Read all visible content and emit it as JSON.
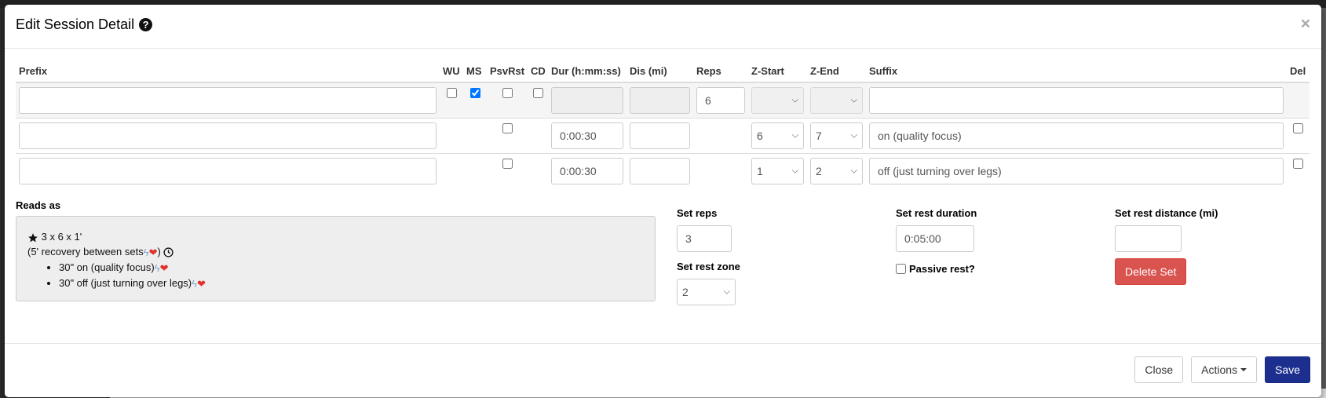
{
  "modal": {
    "title": "Edit Session Detail",
    "close_glyph": "×"
  },
  "table": {
    "headers": {
      "prefix": "Prefix",
      "wu": "WU",
      "ms": "MS",
      "psvrst": "PsvRst",
      "cd": "CD",
      "dur": "Dur (h:mm:ss)",
      "dis": "Dis (mi)",
      "reps": "Reps",
      "zstart": "Z-Start",
      "zend": "Z-End",
      "suffix": "Suffix",
      "del": "Del"
    },
    "rows": [
      {
        "prefix": "",
        "wu": false,
        "ms": true,
        "psvrst": false,
        "cd": false,
        "dur": "",
        "dis": "",
        "reps": "6",
        "zstart": "",
        "zend": "",
        "suffix": ""
      },
      {
        "prefix": "",
        "psvrst": false,
        "dur": "0:00:30",
        "dis": "",
        "zstart": "6",
        "zend": "7",
        "suffix": "on (quality focus)",
        "del": false
      },
      {
        "prefix": "",
        "psvrst": false,
        "dur": "0:00:30",
        "dis": "",
        "zstart": "1",
        "zend": "2",
        "suffix": "off (just turning over legs)",
        "del": false
      }
    ]
  },
  "reads_as": {
    "label": "Reads as",
    "line1": "3 x 6 x 1'",
    "line2": "(5' recovery between sets",
    "line2_close": ")",
    "items": [
      "30\" on (quality focus)",
      "30\" off (just turning over legs)"
    ]
  },
  "set": {
    "reps_label": "Set reps",
    "reps_value": "3",
    "rest_zone_label": "Set rest zone",
    "rest_zone_value": "2",
    "rest_duration_label": "Set rest duration",
    "rest_duration_value": "0:05:00",
    "passive_rest_label": "Passive rest?",
    "passive_rest_checked": false,
    "rest_distance_label": "Set rest distance (mi)",
    "rest_distance_value": "",
    "delete_set_label": "Delete Set"
  },
  "footer": {
    "close_label": "Close",
    "actions_label": "Actions",
    "save_label": "Save"
  },
  "colors": {
    "primary": "#1c2f8f",
    "danger": "#d9534f",
    "bolt": "#7fa7c9",
    "heart": "#e0322b"
  }
}
